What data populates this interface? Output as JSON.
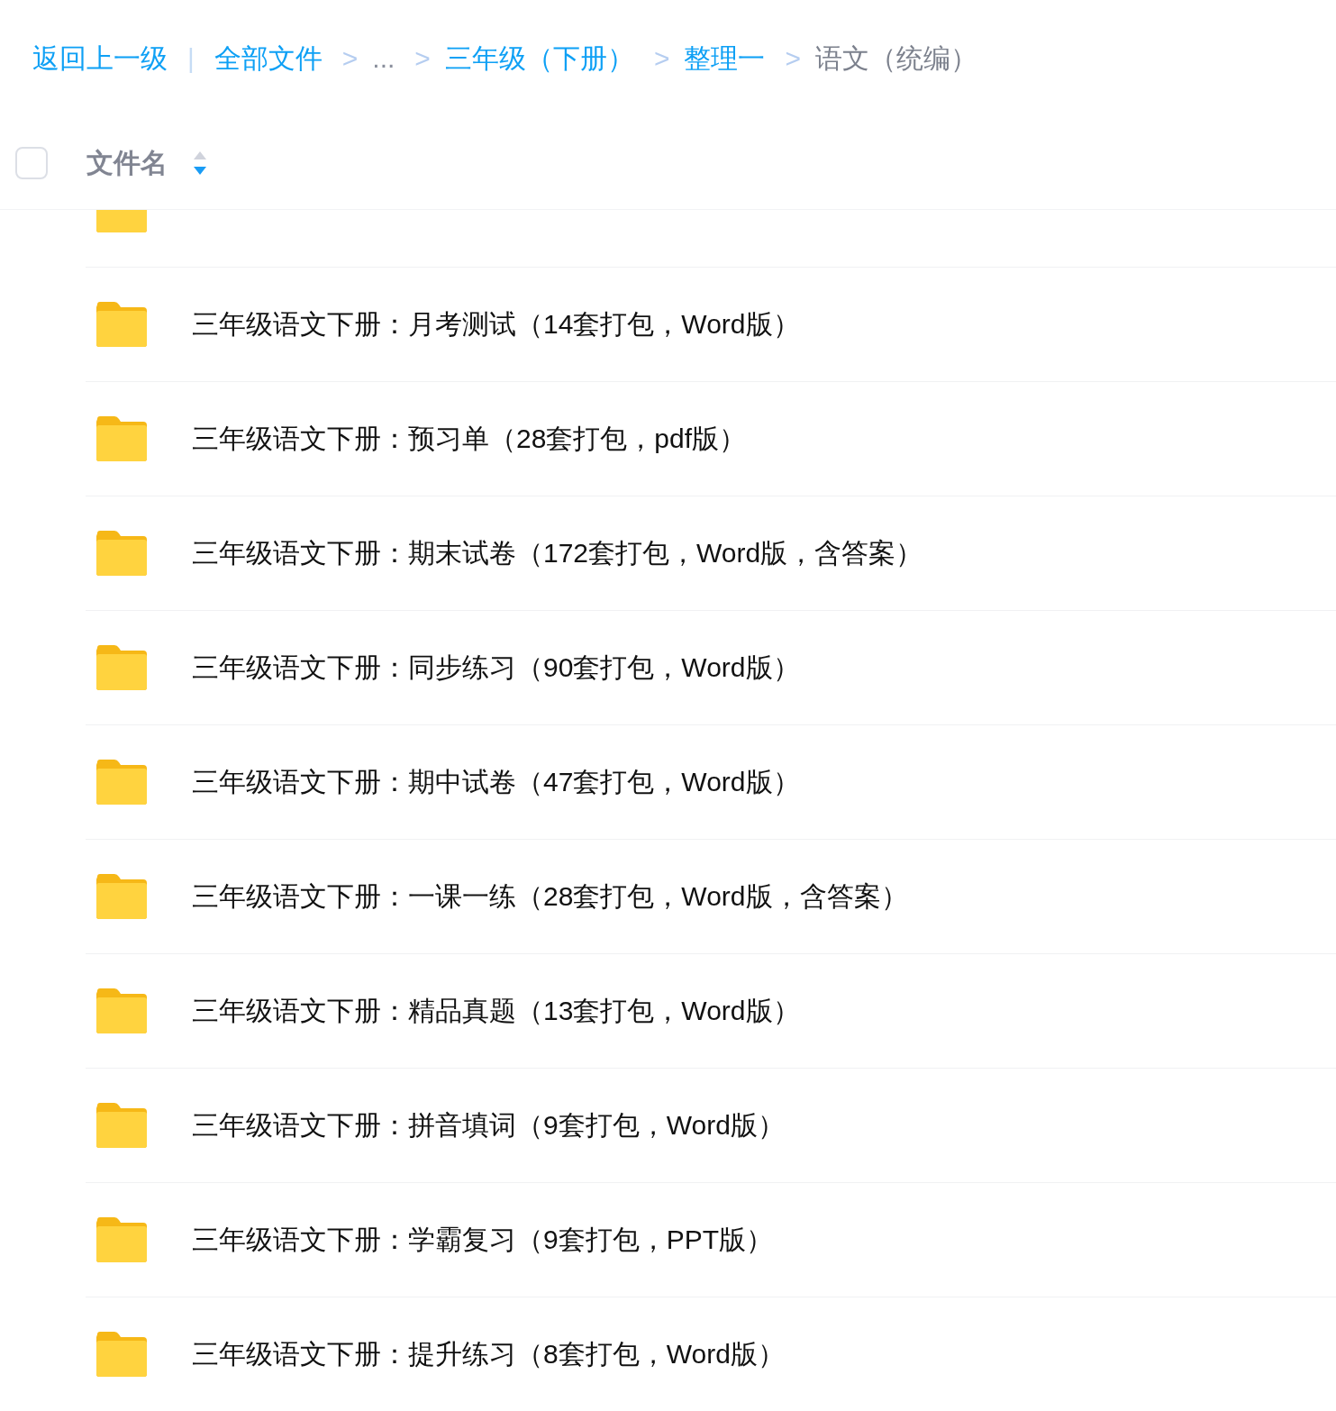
{
  "breadcrumb": {
    "back": "返回上一级",
    "back_separator": "|",
    "items": [
      {
        "label": "全部文件",
        "kind": "link"
      },
      {
        "label": "...",
        "kind": "ellipsis",
        "separator": ">"
      },
      {
        "label": "三年级（下册）",
        "kind": "link",
        "separator": ">"
      },
      {
        "label": "整理一",
        "kind": "link",
        "separator": ">"
      },
      {
        "label": "语文（统编）",
        "kind": "current",
        "separator": ">"
      }
    ]
  },
  "table": {
    "select_all": {
      "checked": false
    },
    "columns": [
      {
        "label": "文件名",
        "sort_descending": true
      }
    ],
    "rows": [
      {
        "kind": "folder"
      },
      {
        "name": "三年级语文下册：月考测试（14套打包，Word版）",
        "kind": "folder"
      },
      {
        "name": "三年级语文下册：预习单（28套打包，pdf版）",
        "kind": "folder"
      },
      {
        "name": "三年级语文下册：期末试卷（172套打包，Word版，含答案）",
        "kind": "folder"
      },
      {
        "name": "三年级语文下册：同步练习（90套打包，Word版）",
        "kind": "folder"
      },
      {
        "name": "三年级语文下册：期中试卷（47套打包，Word版）",
        "kind": "folder"
      },
      {
        "name": "三年级语文下册：一课一练（28套打包，Word版，含答案）",
        "kind": "folder"
      },
      {
        "name": "三年级语文下册：精品真题（13套打包，Word版）",
        "kind": "folder"
      },
      {
        "name": "三年级语文下册：拼音填词（9套打包，Word版）",
        "kind": "folder"
      },
      {
        "name": "三年级语文下册：学霸复习（9套打包，PPT版）",
        "kind": "folder"
      },
      {
        "name": "三年级语文下册：提升练习（8套打包，Word版）",
        "kind": "folder"
      }
    ]
  }
}
